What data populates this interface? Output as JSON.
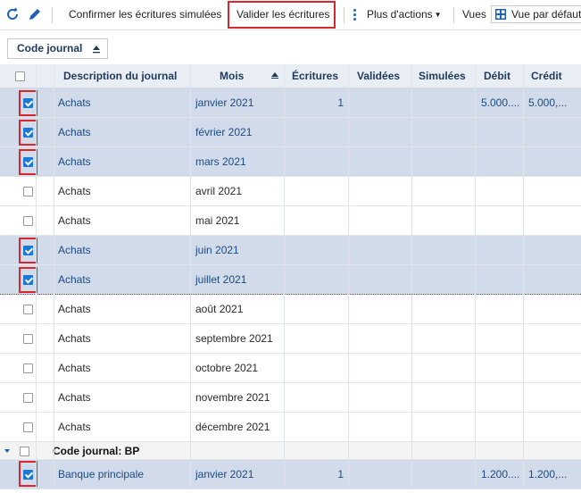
{
  "toolbar": {
    "refresh_icon": "refresh-icon",
    "edit_icon": "pencil-icon",
    "confirm_label": "Confirmer les écritures simulées",
    "validate_label": "Valider les écritures",
    "more_label": "Plus d'actions",
    "views_label": "Vues",
    "view_value": "Vue par défaut",
    "highlight_color": "#d9262f"
  },
  "group_chip": {
    "label": "Code journal"
  },
  "columns": [
    "Description du journal",
    "Mois",
    "Écritures",
    "Validées",
    "Simulées",
    "Débit",
    "Crédit"
  ],
  "rows": [
    {
      "desc": "Achats",
      "mois": "janvier 2021",
      "ecritures": "1",
      "debit": "5.000....",
      "credit": "5.000,...",
      "checked": true
    },
    {
      "desc": "Achats",
      "mois": "février 2021",
      "ecritures": "",
      "debit": "",
      "credit": "",
      "checked": true
    },
    {
      "desc": "Achats",
      "mois": "mars 2021",
      "ecritures": "",
      "debit": "",
      "credit": "",
      "checked": true
    },
    {
      "desc": "Achats",
      "mois": "avril 2021",
      "ecritures": "",
      "debit": "",
      "credit": "",
      "checked": false
    },
    {
      "desc": "Achats",
      "mois": "mai 2021",
      "ecritures": "",
      "debit": "",
      "credit": "",
      "checked": false
    },
    {
      "desc": "Achats",
      "mois": "juin 2021",
      "ecritures": "",
      "debit": "",
      "credit": "",
      "checked": true
    },
    {
      "desc": "Achats",
      "mois": "juillet 2021",
      "ecritures": "",
      "debit": "",
      "credit": "",
      "checked": true
    },
    {
      "desc": "Achats",
      "mois": "août 2021",
      "ecritures": "",
      "debit": "",
      "credit": "",
      "checked": false
    },
    {
      "desc": "Achats",
      "mois": "septembre 2021",
      "ecritures": "",
      "debit": "",
      "credit": "",
      "checked": false
    },
    {
      "desc": "Achats",
      "mois": "octobre 2021",
      "ecritures": "",
      "debit": "",
      "credit": "",
      "checked": false
    },
    {
      "desc": "Achats",
      "mois": "novembre 2021",
      "ecritures": "",
      "debit": "",
      "credit": "",
      "checked": false
    },
    {
      "desc": "Achats",
      "mois": "décembre 2021",
      "ecritures": "",
      "debit": "",
      "credit": "",
      "checked": false
    }
  ],
  "group_bp": {
    "label": "Code journal: BP"
  },
  "bp_row": {
    "desc": "Banque principale",
    "mois": "janvier 2021",
    "ecritures": "1",
    "debit": "1.200....",
    "credit": "1.200,...",
    "checked": true
  }
}
